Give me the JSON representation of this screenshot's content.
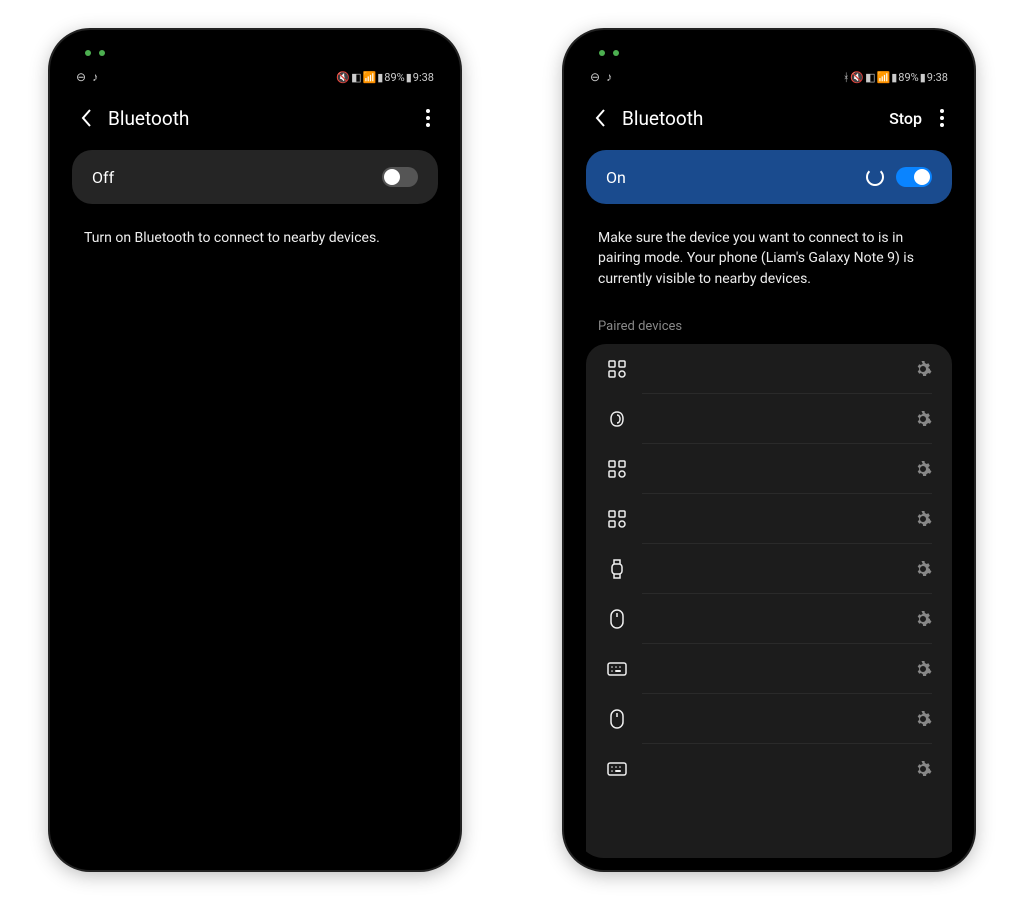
{
  "left": {
    "status": {
      "battery": "89%",
      "time": "9:38"
    },
    "title": "Bluetooth",
    "toggle_label": "Off",
    "help": "Turn on Bluetooth to connect to nearby devices."
  },
  "right": {
    "status": {
      "battery": "89%",
      "time": "9:38"
    },
    "title": "Bluetooth",
    "stop": "Stop",
    "toggle_label": "On",
    "help": "Make sure the device you want to connect to is in pairing mode. Your phone (Liam's Galaxy Note 9) is currently visible to nearby devices.",
    "section": "Paired devices",
    "devices": [
      {
        "icon": "grid"
      },
      {
        "icon": "earbud"
      },
      {
        "icon": "grid"
      },
      {
        "icon": "grid"
      },
      {
        "icon": "watch"
      },
      {
        "icon": "mouse"
      },
      {
        "icon": "keyboard"
      },
      {
        "icon": "mouse"
      },
      {
        "icon": "keyboard"
      }
    ]
  }
}
